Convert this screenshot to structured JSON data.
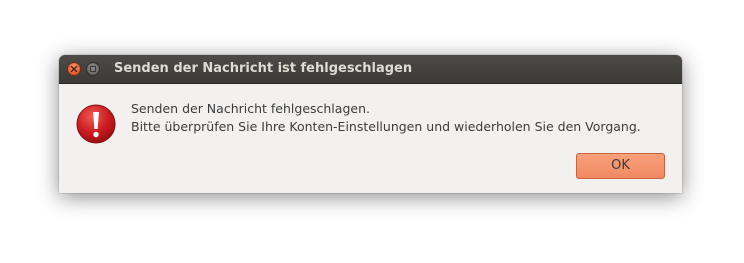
{
  "window": {
    "title": "Senden der Nachricht ist fehlgeschlagen"
  },
  "message": {
    "line1": "Senden der Nachricht fehlgeschlagen.",
    "line2": "Bitte überprüfen Sie Ihre Konten-Einstellungen und wiederholen Sie den Vorgang."
  },
  "buttons": {
    "ok_label": "OK"
  },
  "icons": {
    "dialog": "error-icon",
    "close": "close-icon",
    "minimize": "minimize-icon"
  },
  "colors": {
    "titlebar": "#3c3b37",
    "dialog_bg": "#f2f1f0",
    "accent": "#f08a63",
    "error_red": "#c8161d"
  }
}
